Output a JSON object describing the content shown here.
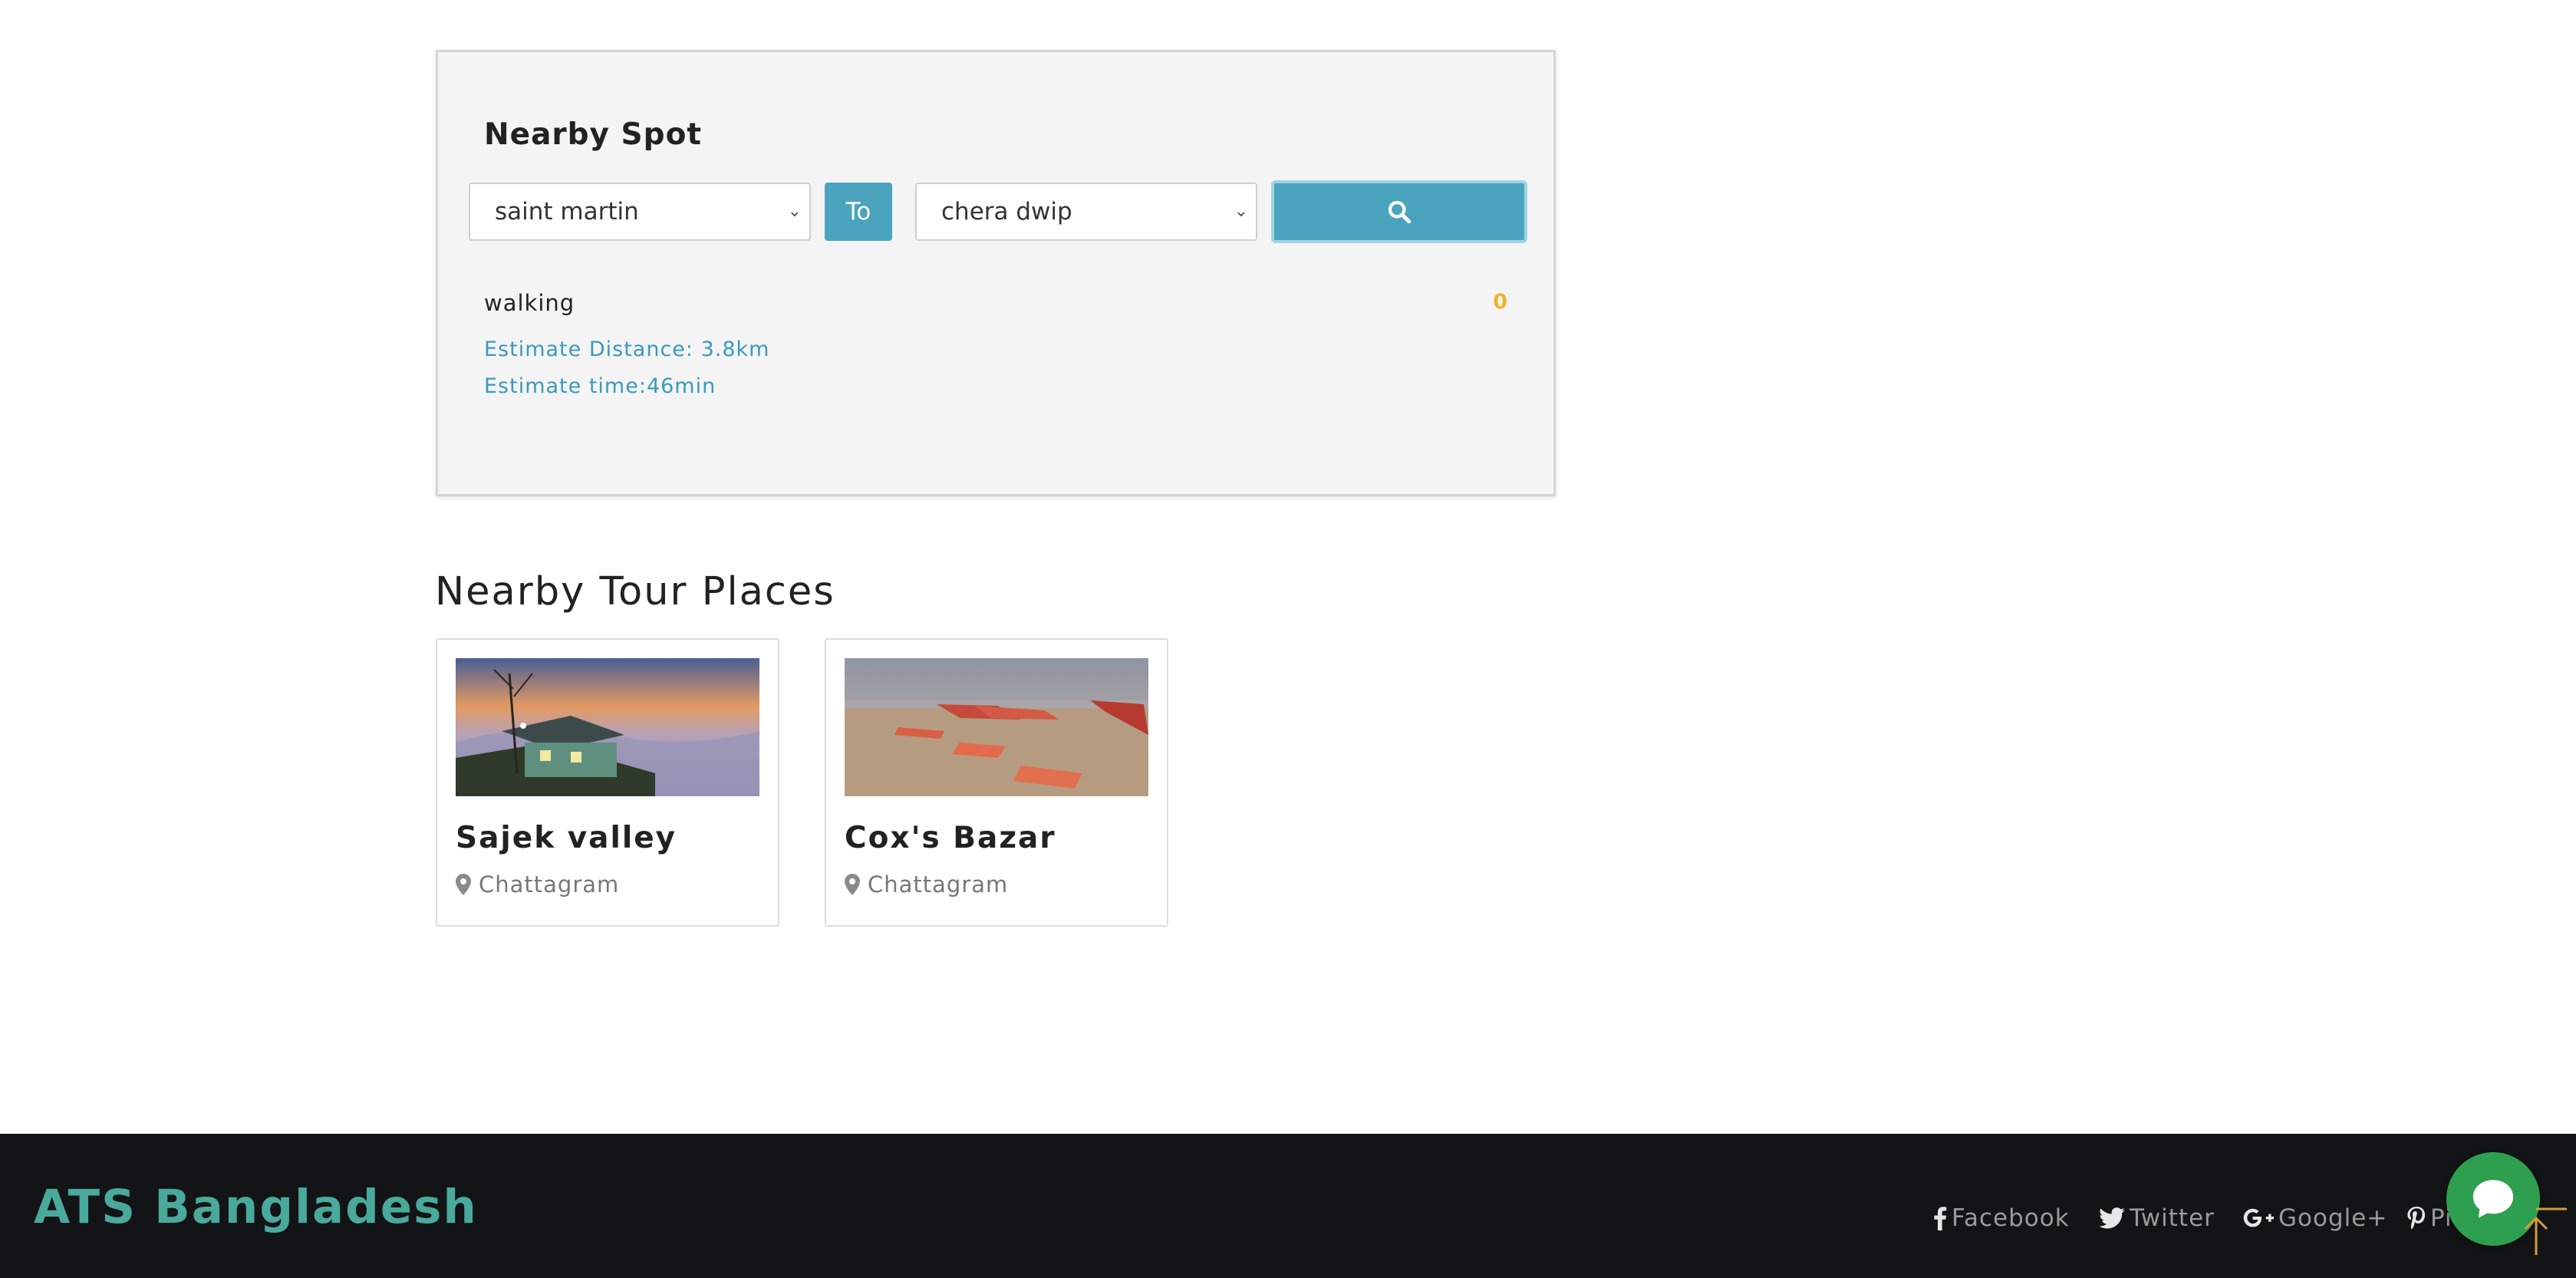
{
  "nearby_spot": {
    "title": "Nearby Spot",
    "from_value": "saint martin",
    "to_label": "To",
    "to_value": "chera dwip",
    "search_icon": "search-icon",
    "mode": "walking",
    "count": "0",
    "distance": "Estimate Distance: 3.8km",
    "time": "Estimate time:46min",
    "accent_color": "#4ba4bd"
  },
  "tour_places": {
    "title": "Nearby Tour Places",
    "items": [
      {
        "name": "Sajek valley",
        "location": "Chattagram",
        "image": "cottage-at-sunset-photo"
      },
      {
        "name": "Cox's Bazar",
        "location": "Chattagram",
        "image": "beach-with-chairs-photo"
      }
    ]
  },
  "footer": {
    "brand": "ATS Bangladesh",
    "brand_color": "#49a99b",
    "social": [
      {
        "label": "Facebook",
        "icon": "facebook-icon"
      },
      {
        "label": "Twitter",
        "icon": "twitter-icon"
      },
      {
        "label": "Google+",
        "icon": "google-plus-icon"
      },
      {
        "label": "Pi",
        "icon": "pinterest-icon"
      }
    ],
    "chat_icon": "chat-icon",
    "chat_color": "#2e9f4f"
  }
}
